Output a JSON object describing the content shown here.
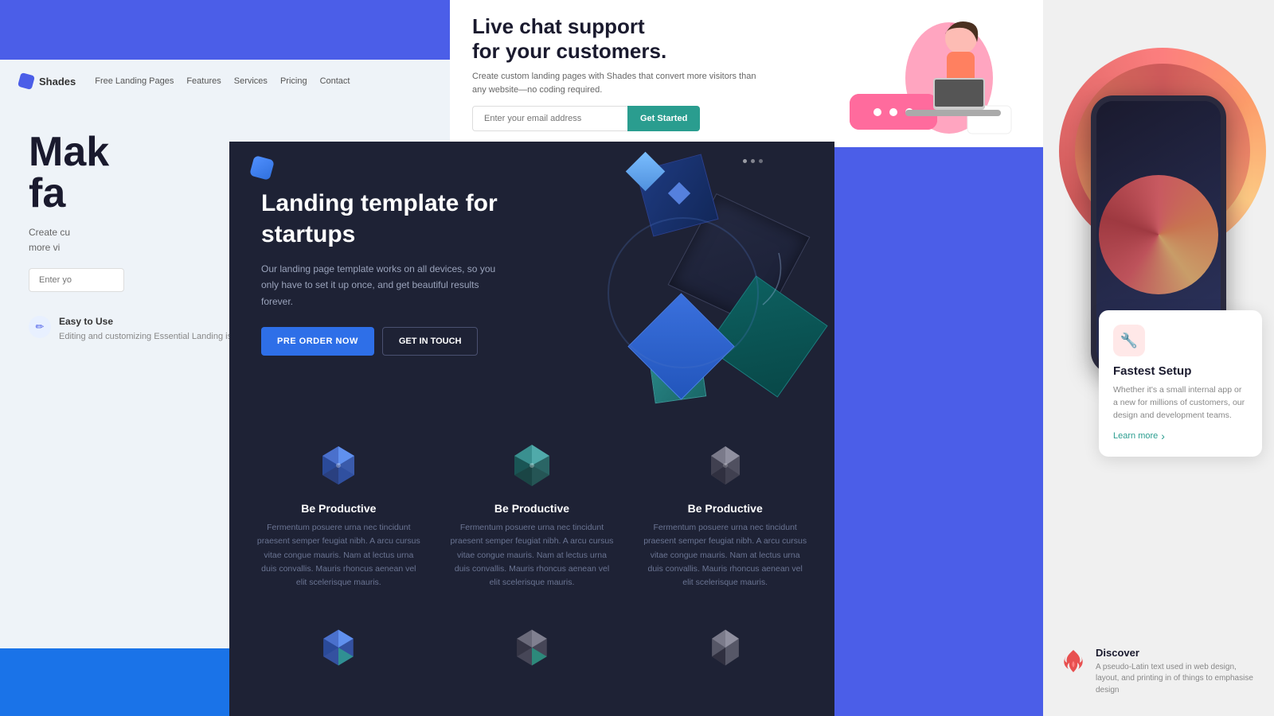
{
  "left_panel": {
    "nav": {
      "logo_text": "Shades",
      "links": [
        "Free Landing Pages",
        "Features",
        "Services",
        "Pricing",
        "Contact"
      ]
    },
    "hero": {
      "title_line1": "Mak",
      "title_line2": "fa",
      "description": "Create cu more vi",
      "email_placeholder": "Enter yo"
    },
    "feature": {
      "icon": "✏",
      "title": "Easy to Use",
      "description": "Editing and customizing Essential Landing is easy and fast."
    }
  },
  "top_right_panel": {
    "title_line1": "Live chat support",
    "title_line2": "for your customers.",
    "description": "Create custom landing pages with Shades that convert more visitors than any website—no coding required.",
    "email_placeholder": "Enter your email address",
    "button_text": "Get Started"
  },
  "center_dark_panel": {
    "title": "Landing template for startups",
    "description": "Our landing page template works on all devices, so you only have to set it up once, and get beautiful results forever.",
    "buttons": {
      "primary": "PRE ORDER NOW",
      "secondary": "GET IN TOUCH"
    },
    "features": [
      {
        "title": "Be Productive",
        "description": "Fermentum posuere urna nec tincidunt praesent semper feugiat nibh. A arcu cursus vitae congue mauris. Nam at lectus urna duis convallis. Mauris rhoncus aenean vel elit scelerisque mauris.",
        "icon_color": "#4A90E8"
      },
      {
        "title": "Be Productive",
        "description": "Fermentum posuere urna nec tincidunt praesent semper feugiat nibh. A arcu cursus vitae congue mauris. Nam at lectus urna duis convallis. Mauris rhoncus aenean vel elit scelerisque mauris.",
        "icon_color": "#4A90E8"
      },
      {
        "title": "Be Productive",
        "description": "Fermentum posuere urna nec tincidunt praesent semper feugiat nibh. A arcu cursus vitae congue mauris. Nam at lectus urna duis convallis. Mauris rhoncus aenean vel elit scelerisque mauris.",
        "icon_color": "#7A8AAA"
      }
    ],
    "bottom_icons": [
      "icon1",
      "icon2",
      "icon3"
    ]
  },
  "right_panel": {
    "card": {
      "icon": "🔧",
      "title": "Fastest Setup",
      "description": "Whether it's a small internal app or a new for millions of customers, our design and development teams.",
      "link_text": "Learn more",
      "link_arrow": "›"
    },
    "discover": {
      "title": "Discover",
      "description": "A pseudo-Latin text used in web design, layout, and printing in of things to emphasise design"
    }
  }
}
